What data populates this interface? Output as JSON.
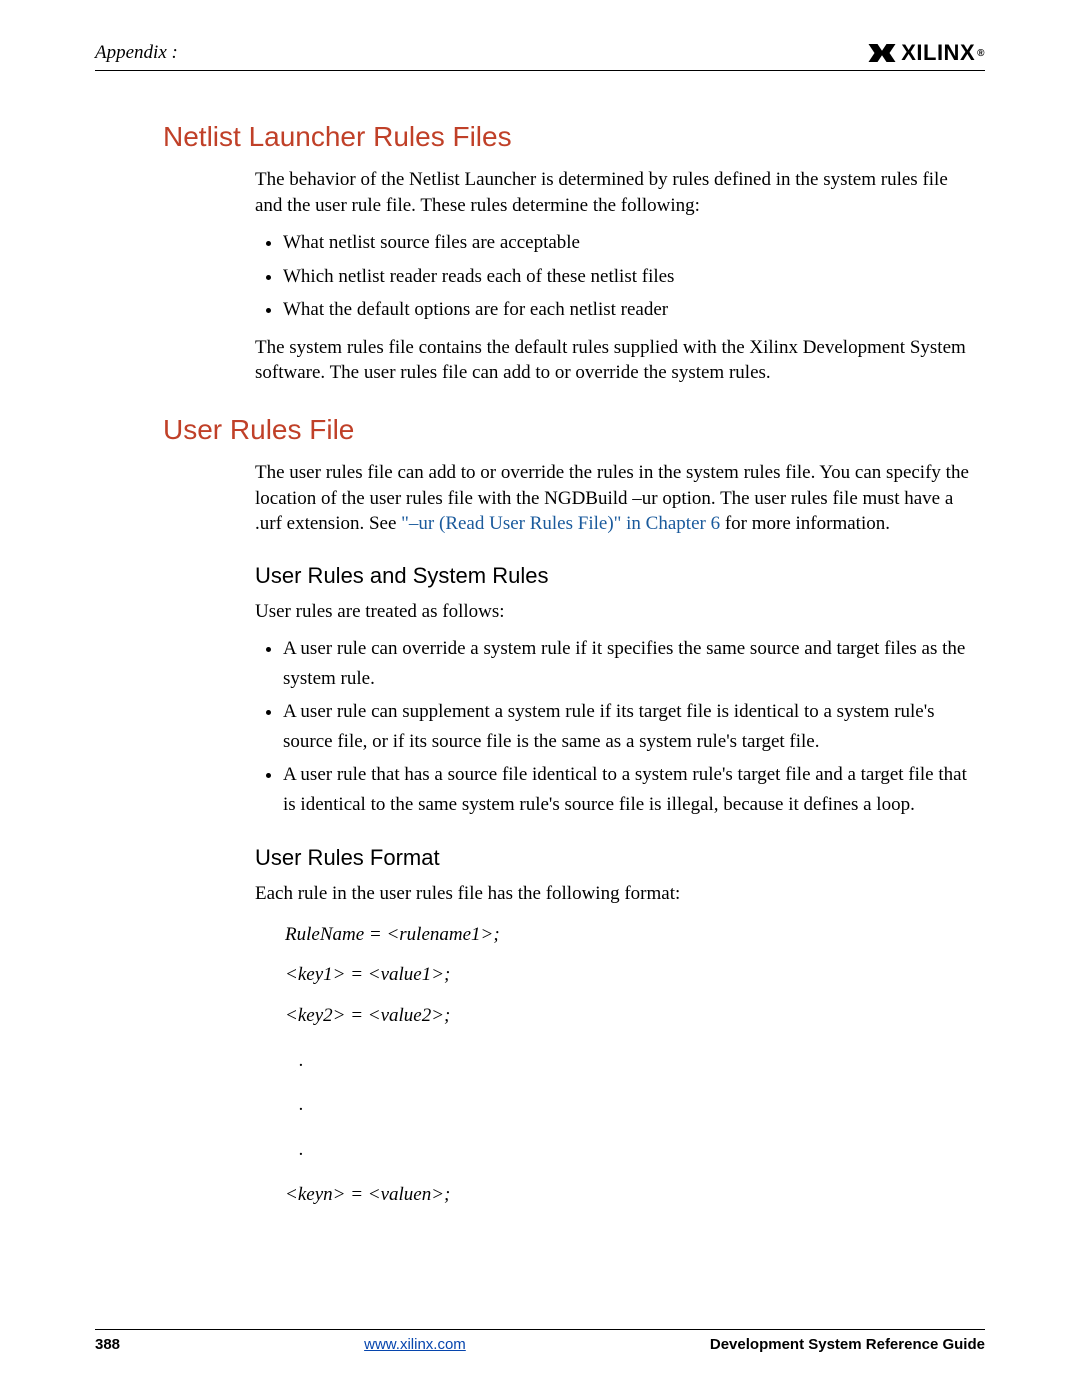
{
  "header": {
    "appendix": "Appendix :",
    "logo_text": "XILINX",
    "logo_reg": "®"
  },
  "section1": {
    "title": "Netlist Launcher Rules Files",
    "p1": "The behavior of the Netlist Launcher is determined by rules defined in the system rules file and the user rule file. These rules determine the following:",
    "bullets": [
      "What netlist source files are acceptable",
      "Which netlist reader reads each of these netlist files",
      "What the default options are for each netlist reader"
    ],
    "p2": "The system rules file contains the default rules supplied with the Xilinx Development System software. The user rules file can add to or override the system rules."
  },
  "section2": {
    "title": "User Rules File",
    "p1a": "The user rules file can add to or override the rules in the system rules file. You can specify the location of the user rules file with the NGDBuild –ur option. The user rules file must have a .urf extension. See ",
    "link": "\"–ur (Read User Rules File)\" in Chapter 6",
    "p1b": " for more information.",
    "sub1": {
      "title": "User Rules and System Rules",
      "intro": "User rules are treated as follows:",
      "bullets": [
        "A user rule can override a system rule if it specifies the same source and target files as the system rule.",
        "A user rule can supplement a system rule if its target file is identical to a system rule's source file, or if its source file is the same as a system rule's target file.",
        "A user rule that has a source file identical to a system rule's target file and a target file that is identical to the same system rule's source file is illegal, because it defines a loop."
      ]
    },
    "sub2": {
      "title": "User Rules Format",
      "intro": "Each rule in the user rules file has the following format:",
      "code": {
        "l1": "RuleName = <rulename1>;",
        "l2": "<key1> = <value1>;",
        "l3": "<key2> = <value2>;",
        "d1": ".",
        "d2": ".",
        "d3": ".",
        "l4": "<keyn> = <valuen>;"
      }
    }
  },
  "footer": {
    "page": "388",
    "url": "www.xilinx.com",
    "guide": "Development System Reference Guide"
  }
}
